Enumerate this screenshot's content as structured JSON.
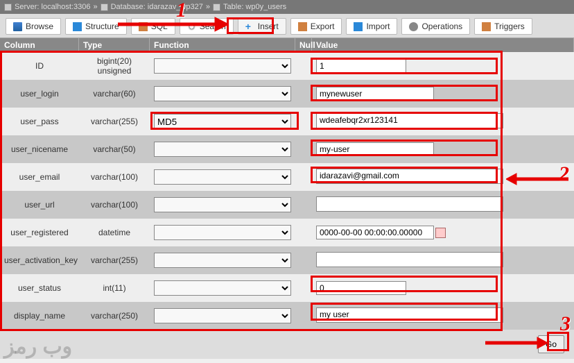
{
  "titlebar": {
    "server": "Server: localhost:3306",
    "database": "Database: idarazav_wp327",
    "table": "Table: wp0y_users"
  },
  "tabs": {
    "browse": "Browse",
    "structure": "Structure",
    "sql": "SQL",
    "search": "Search",
    "insert": "Insert",
    "export": "Export",
    "import": "Import",
    "operations": "Operations",
    "triggers": "Triggers"
  },
  "headers": {
    "column": "Column",
    "type": "Type",
    "function": "Function",
    "null": "Null",
    "value": "Value"
  },
  "rows": [
    {
      "name": "ID",
      "type": "bigint(20) unsigned",
      "func": "",
      "value": "1",
      "input": "narrow"
    },
    {
      "name": "user_login",
      "type": "varchar(60)",
      "func": "",
      "value": "mynewuser",
      "input": "wide"
    },
    {
      "name": "user_pass",
      "type": "varchar(255)",
      "func": "MD5",
      "value": "wdeafebqr2xr123141",
      "input": "textarea"
    },
    {
      "name": "user_nicename",
      "type": "varchar(50)",
      "func": "",
      "value": "my-user",
      "input": "wide"
    },
    {
      "name": "user_email",
      "type": "varchar(100)",
      "func": "",
      "value": "idarazavi@gmail.com",
      "input": "textarea"
    },
    {
      "name": "user_url",
      "type": "varchar(100)",
      "func": "",
      "value": "",
      "input": "textarea"
    },
    {
      "name": "user_registered",
      "type": "datetime",
      "func": "",
      "value": "0000-00-00 00:00:00.00000",
      "input": "wide",
      "calendar": true
    },
    {
      "name": "user_activation_key",
      "type": "varchar(255)",
      "func": "",
      "value": "",
      "input": "textarea"
    },
    {
      "name": "user_status",
      "type": "int(11)",
      "func": "",
      "value": "0",
      "input": "narrow"
    },
    {
      "name": "display_name",
      "type": "varchar(250)",
      "func": "",
      "value": "my user",
      "input": "textarea"
    }
  ],
  "buttons": {
    "go": "Go"
  },
  "annotations": {
    "n1": "1",
    "n2": "2",
    "n3": "3"
  },
  "watermark": "وب رمز"
}
